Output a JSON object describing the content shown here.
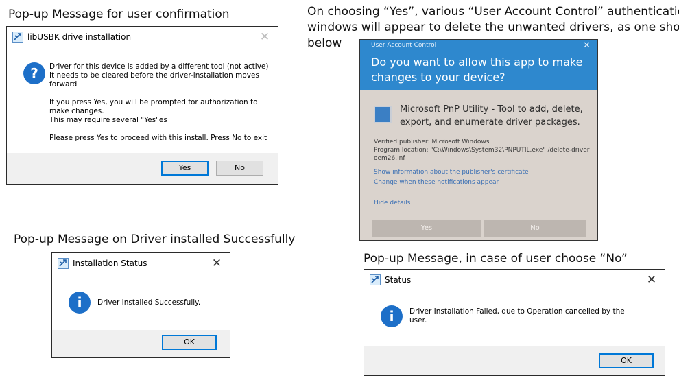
{
  "captions": {
    "confirmation": "Pop-up Message for user confirmation",
    "uac_line1": "On choosing “Yes”, various “User Account Control” authentications",
    "uac_line2": "windows will appear to delete the unwanted drivers, as one shown",
    "uac_line3": "below",
    "success": "Pop-up Message on Driver installed Successfully",
    "no": "Pop-up Message, in case of user choose “No”"
  },
  "dialog_install": {
    "title": "libUSBK drive installation",
    "icon": "question-icon",
    "icon_glyph": "?",
    "message_lines": [
      "Driver for this device is added by a different tool (not active)",
      "It needs to be cleared before the driver-installation moves",
      "forward",
      "",
      "If you press Yes, you will be prompted for authorization to",
      "make changes.",
      "This may require several \"Yes\"es",
      "",
      "Please press Yes to proceed with this install. Press No to exit"
    ],
    "yes_label": "Yes",
    "no_label": "No"
  },
  "uac": {
    "title": "User Account Control",
    "question": "Do you want to allow this app to make changes to your device?",
    "app_name": "Microsoft PnP Utility - Tool to add, delete, export, and enumerate driver packages.",
    "publisher": "Verified publisher: Microsoft Windows",
    "location": "Program location: \"C:\\Windows\\System32\\PNPUTIL.exe\" /delete-driver oem26.inf",
    "cert_link": "Show information about the publisher's certificate",
    "notif_link": "Change when these notifications appear",
    "hide_link": "Hide details",
    "yes_label": "Yes",
    "no_label": "No",
    "colors": {
      "header": "#2e88ce",
      "body": "#dad3cd"
    }
  },
  "dialog_success": {
    "title": "Installation Status",
    "icon": "info-icon",
    "icon_glyph": "i",
    "message": "Driver Installed Successfully.",
    "ok_label": "OK"
  },
  "dialog_failed": {
    "title": "Status",
    "icon": "info-icon",
    "icon_glyph": "i",
    "message_lines": [
      "Driver Installation Failed, due to Operation cancelled by the",
      "user."
    ],
    "ok_label": "OK"
  }
}
